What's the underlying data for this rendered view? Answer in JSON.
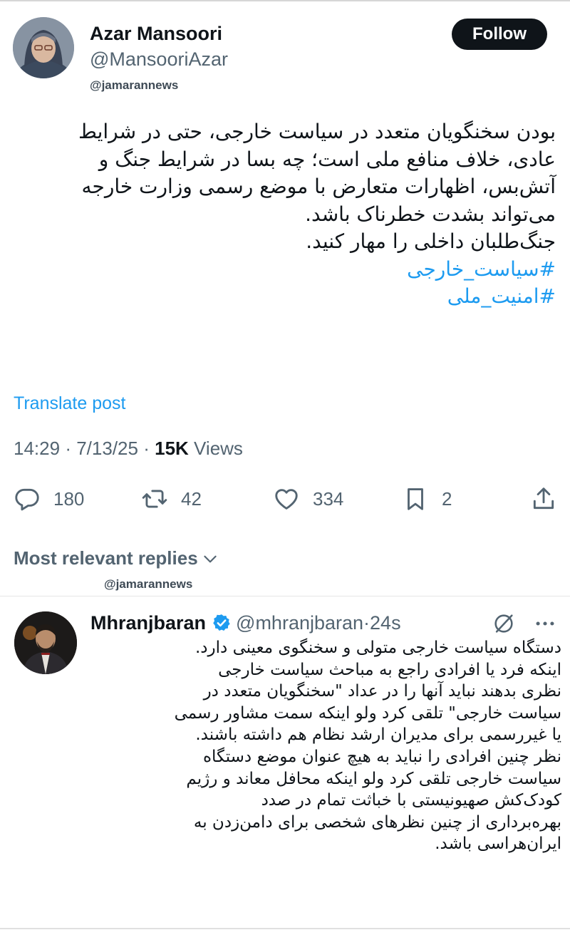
{
  "post": {
    "author_name": "Azar Mansoori",
    "author_handle": "@MansooriAzar",
    "follow_label": "Follow",
    "watermark": "@jamarannews",
    "text_lines": [
      "بودن سخنگویان متعدد در سیاست خارجی، حتی در شرایط",
      "عادی، خلاف منافع ملی است؛ چه بسا در شرایط جنگ و",
      "آتش‌بس، اظهارات متعارض با موضع رسمی وزارت خارجه",
      "می‌تواند بشدت خطرناک باشد.",
      "جنگ‌طلبان داخلی را مهار کنید."
    ],
    "hashtags": [
      "#سیاست_خارجی",
      "#امنیت_ملی"
    ],
    "translate_label": "Translate post",
    "time": "14:29",
    "date": "7/13/25",
    "views_count": "15K",
    "views_label": "Views",
    "separator": "·",
    "replies": "180",
    "reposts": "42",
    "likes": "334",
    "bookmarks": "2"
  },
  "replies_section": {
    "label": "Most relevant replies",
    "watermark": "@jamarannews"
  },
  "reply": {
    "author_name": "Mhranjbaran",
    "author_handle": "@mhranjbaran",
    "separator": "·",
    "time": "24s",
    "text_lines": [
      "دستگاه سیاست خارجی متولی و سخنگوی معینی دارد.",
      "اینکه فرد یا افرادی راجع به مباحث سیاست خارجی",
      "نظری بدهند نباید آنها را در عداد \"سخنگویان متعدد در",
      "سیاست خارجی\" تلقی کرد ولو اینکه سمت مشاور رسمی",
      "یا غیررسمی برای مدیران ارشد  نظام هم داشته باشند.",
      "نظر چنین افرادی را نباید به هیچ عنوان موضع دستگاه",
      "سیاست خارجی تلقی کرد ولو اینکه محافل معاند و رژیم",
      "کودک‌کش صهیونیستی با خباثت تمام در صدد",
      "بهره‌برداری از چنین نظرهای شخصی برای دامن‌زدن به",
      "ایران‌هراسی باشد."
    ]
  },
  "colors": {
    "accent": "#1d9bf0",
    "text": "#0f1419",
    "secondary": "#536471"
  },
  "icons": {
    "reply": "reply-icon",
    "repost": "repost-icon",
    "like": "heart-icon",
    "bookmark": "bookmark-icon",
    "share": "share-icon",
    "verified": "verified-badge-icon",
    "grok": "grok-icon",
    "more": "more-icon",
    "chevron": "chevron-down-icon"
  }
}
